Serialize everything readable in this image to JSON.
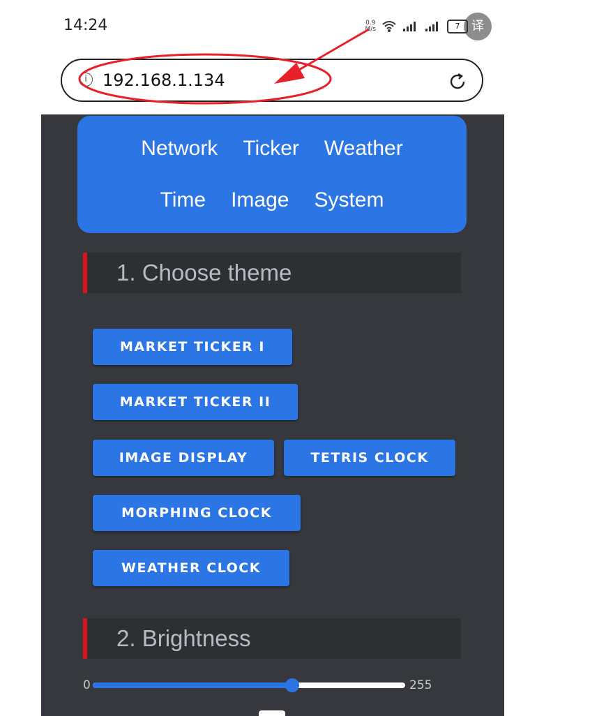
{
  "status_bar": {
    "time": "14:24",
    "net_speed_value": "0.9",
    "net_speed_unit": "M/s",
    "battery": "7",
    "translate_badge": "译"
  },
  "address_bar": {
    "url": "192.168.1.134",
    "info_glyph": "i"
  },
  "nav": {
    "row1": [
      "Network",
      "Ticker",
      "Weather"
    ],
    "row2": [
      "Time",
      "Image",
      "System"
    ]
  },
  "sections": {
    "theme_title": "1. Choose theme",
    "brightness_title": "2. Brightness"
  },
  "theme_buttons": [
    "MARKET TICKER I",
    "MARKET TICKER II",
    "IMAGE DISPLAY",
    "TETRIS CLOCK",
    "MORPHING CLOCK",
    "WEATHER CLOCK"
  ],
  "brightness": {
    "min": "0",
    "max": "255",
    "value": 163
  },
  "colors": {
    "accent_blue": "#2b75e4",
    "page_bg": "#36383d",
    "section_marker_red": "#d9141a",
    "annotation_red": "#e8202a"
  },
  "icons": [
    "wifi-icon",
    "signal-icon",
    "battery-icon",
    "info-icon",
    "reload-icon",
    "translate-icon"
  ]
}
